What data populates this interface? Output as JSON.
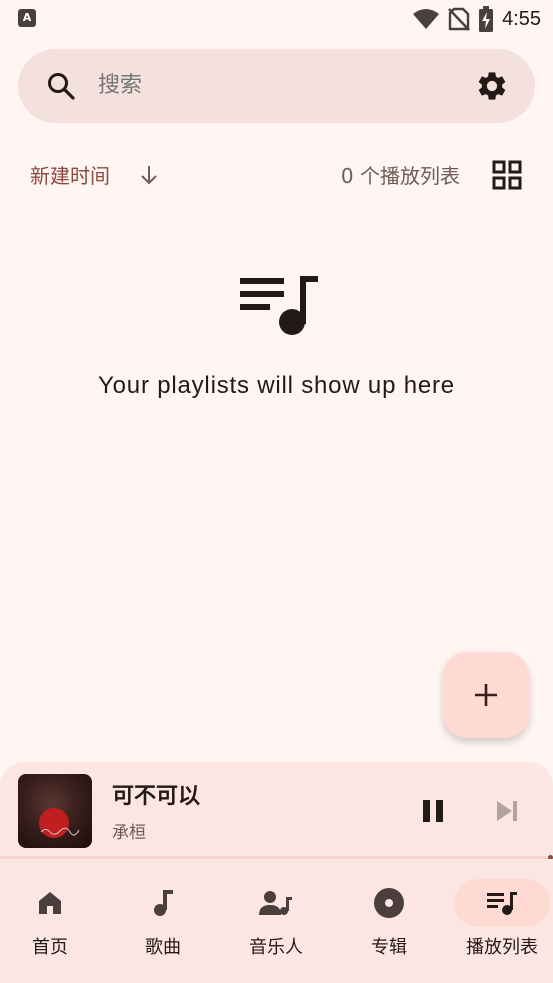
{
  "status_bar": {
    "time": "4:55",
    "left_icon": "a-notification-icon",
    "icons": [
      "wifi-icon",
      "no-sim-icon",
      "battery-charging-icon"
    ]
  },
  "search": {
    "placeholder": "搜索",
    "search_icon": "search-icon",
    "settings_icon": "gear-icon"
  },
  "sort_bar": {
    "sort_label": "新建时间",
    "sort_direction_icon": "arrow-down-icon",
    "count_text": "0 个播放列表",
    "view_toggle_icon": "grid-view-icon"
  },
  "empty_state": {
    "icon": "playlist-music-icon",
    "message": "Your playlists will show up here"
  },
  "fab": {
    "icon": "plus-icon"
  },
  "now_playing": {
    "title": "可不可以",
    "artist": "承桓",
    "progress": 0.99,
    "play_state": "playing",
    "controls": [
      "pause-icon",
      "skip-next-icon"
    ]
  },
  "bottom_nav": {
    "items": [
      {
        "label": "首页",
        "icon": "home-icon",
        "active": false
      },
      {
        "label": "歌曲",
        "icon": "music-note-icon",
        "active": false
      },
      {
        "label": "音乐人",
        "icon": "artist-icon",
        "active": false
      },
      {
        "label": "专辑",
        "icon": "album-icon",
        "active": false
      },
      {
        "label": "播放列表",
        "icon": "playlist-icon",
        "active": true
      }
    ]
  },
  "colors": {
    "background": "#fff5f3",
    "search_bar": "#f4e1de",
    "accent": "#8d4a3d",
    "fab": "#ffdad3",
    "nav_bar": "#fbe6e2",
    "active_indicator": "#ffdad3"
  }
}
